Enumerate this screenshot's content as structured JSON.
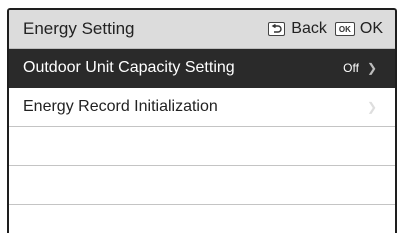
{
  "header": {
    "title": "Energy Setting",
    "back_label": "Back",
    "ok_key": "OK",
    "ok_label": "OK"
  },
  "menu": {
    "items": [
      {
        "label": "Outdoor Unit Capacity Setting",
        "value": "Off",
        "selected": true
      },
      {
        "label": "Energy Record Initialization",
        "value": ""
      }
    ]
  }
}
